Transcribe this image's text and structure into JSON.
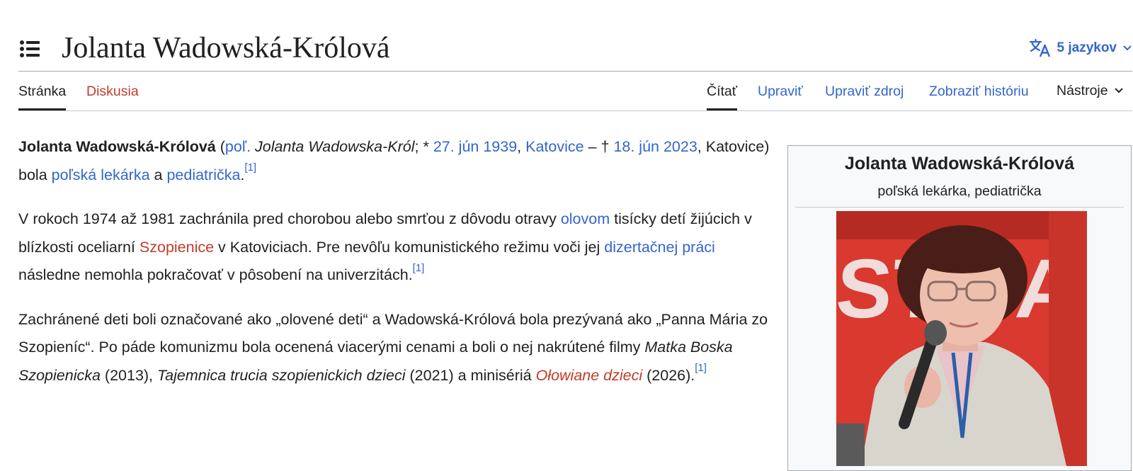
{
  "header": {
    "title": "Jolanta Wadowská-Królová",
    "languages_label": "5 jazykov"
  },
  "tabs": {
    "left": [
      {
        "label": "Stránka",
        "active": true
      },
      {
        "label": "Diskusia",
        "active": false
      }
    ],
    "right": [
      {
        "label": "Čítať",
        "active": true
      },
      {
        "label": "Upraviť"
      },
      {
        "label": "Upraviť zdroj"
      },
      {
        "label": "Zobraziť históriu"
      },
      {
        "label": "Nástroje"
      }
    ]
  },
  "article": {
    "p1": {
      "subject": "Jolanta Wadowská-Królová",
      "t1": " (",
      "lang_abbr": "poľ.",
      "t2": " ",
      "native_name": "Jolanta Wadowska-Król",
      "t3": "; * ",
      "birth_date": "27. jún 1939",
      "t4": ", ",
      "birth_place": "Katovice",
      "t5": " – † ",
      "death_date": "18. jún 2023",
      "t6": ", Katovice) bola ",
      "link_nationality": "poľská lekárka",
      "t7": " a ",
      "link_profession": "pediatrička",
      "t8": ".",
      "ref": "[1]"
    },
    "p2": {
      "t1": "V rokoch 1974 až 1981 zachránila pred chorobou alebo smrťou z dôvodu otravy ",
      "link_lead": "olovom",
      "t2": " tisícky detí žijúcich v blízkosti oceliarní ",
      "link_szopienice": "Szopienice",
      "t3": " v Katoviciach. Pre nevôľu komunistického režimu voči jej ",
      "link_thesis": "dizertačnej práci",
      "t4": " následne nemohla pokračovať v pôsobení na univerzitách.",
      "ref": "[1]"
    },
    "p3": {
      "t1": "Zachránené deti boli označované ako „olovené deti“ a Wadowská-Królová bola prezývaná ako „Panna Mária zo Szopieníc“. Po páde komunizmu bola ocenená viacerými cenami a boli o nej nakrútené filmy ",
      "film1": "Matka Boska Szopienicka",
      "t2": " (2013), ",
      "film2": "Tajemnica trucia szopienickich dzieci",
      "t3": " (2021) a minisériá ",
      "film3": "Ołowiane dzieci",
      "t4": " (2026).",
      "ref": "[1]"
    }
  },
  "infobox": {
    "title": "Jolanta Wadowská-Królová",
    "subtitle": "poľská lekárka, pediatrička",
    "photo_backdrop_text": "STIVAL"
  },
  "colors": {
    "link": "#3366cc",
    "redlink": "#bf3c2c",
    "text": "#202122",
    "infobox_bg": "#f8f9fa",
    "border": "#a2a9b1"
  }
}
